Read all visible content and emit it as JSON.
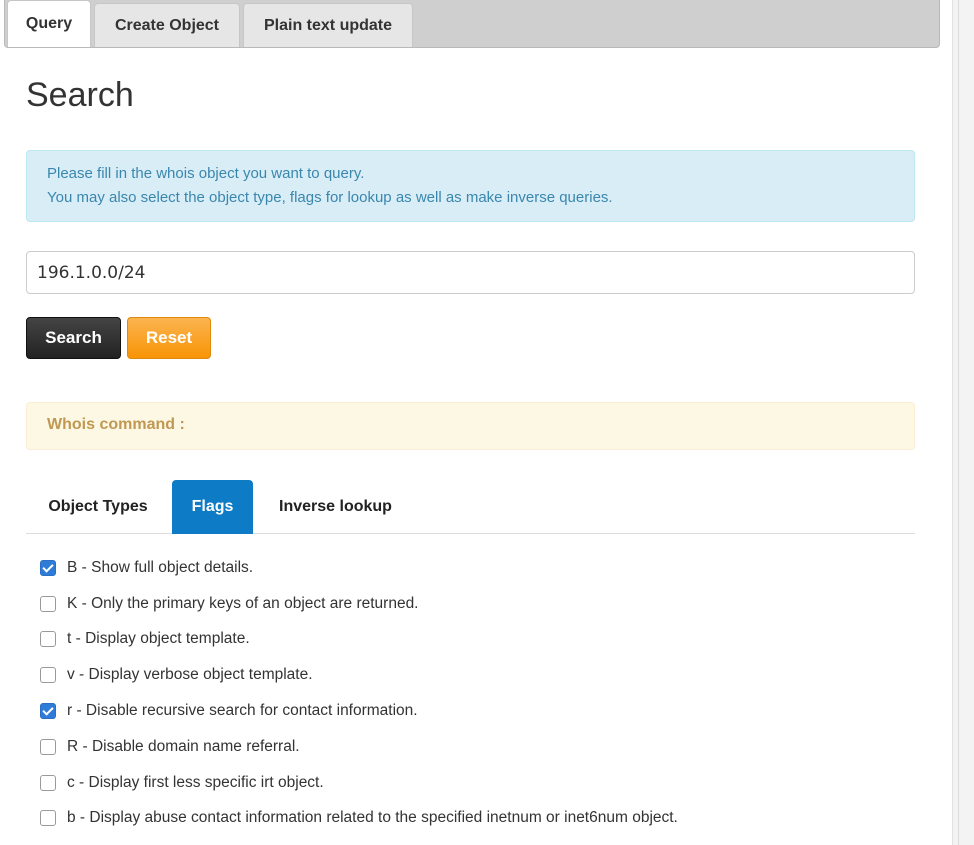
{
  "top_tabs": [
    {
      "label": "Query",
      "active": true
    },
    {
      "label": "Create Object",
      "active": false
    },
    {
      "label": "Plain text update",
      "active": false
    }
  ],
  "page": {
    "title": "Search",
    "info_line1": "Please fill in the whois object you want to query.",
    "info_line2": "You may also select the object type, flags for lookup as well as make inverse queries."
  },
  "search": {
    "value": "196.1.0.0/24",
    "search_label": "Search",
    "reset_label": "Reset"
  },
  "whois": {
    "label": "Whois command :"
  },
  "sub_tabs": [
    {
      "label": "Object Types",
      "active": false
    },
    {
      "label": "Flags",
      "active": true
    },
    {
      "label": "Inverse lookup",
      "active": false
    }
  ],
  "flags": [
    {
      "label": "B - Show full object details.",
      "checked": true
    },
    {
      "label": "K - Only the primary keys of an object are returned.",
      "checked": false
    },
    {
      "label": "t - Display object template.",
      "checked": false
    },
    {
      "label": "v - Display verbose object template.",
      "checked": false
    },
    {
      "label": "r - Disable recursive search for contact information.",
      "checked": true
    },
    {
      "label": "R - Disable domain name referral.",
      "checked": false
    },
    {
      "label": "c - Display first less specific irt object.",
      "checked": false
    },
    {
      "label": "b - Display abuse contact information related to the specified inetnum or inet6num object.",
      "checked": false
    }
  ],
  "colors": {
    "active_tab": "#0e7bc6",
    "info_bg": "#d9edf7",
    "info_text": "#3a87ad",
    "warning_bg": "#fcf8e3",
    "warning_text": "#c09853",
    "reset_button": "#f89406",
    "checkbox_checked": "#2f7bd8"
  }
}
